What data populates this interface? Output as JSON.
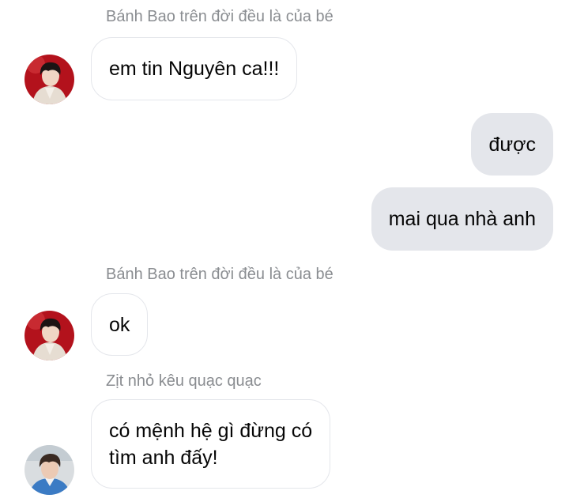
{
  "conversation": {
    "groups": [
      {
        "sender": "Bánh Bao trên đời đều là của bé",
        "avatar": "avatar-dark-red-photo",
        "messages": [
          "em tin Nguyên ca!!!"
        ]
      },
      {
        "outgoing": [
          "được",
          "mai qua nhà anh"
        ]
      },
      {
        "sender": "Bánh Bao trên đời đều là của bé",
        "avatar": "avatar-dark-red-photo",
        "messages": [
          "ok"
        ]
      },
      {
        "sender": "Zịt nhỏ kêu quạc quạc",
        "avatar": "avatar-blue-photo",
        "messages": [
          "có mệnh hệ gì đừng có\ntìm anh đấy!"
        ]
      }
    ]
  },
  "colors": {
    "incoming_border": "#e4e6eb",
    "outgoing_bg": "#e4e6eb",
    "sender_name": "#8a8d91",
    "text": "#050505"
  }
}
